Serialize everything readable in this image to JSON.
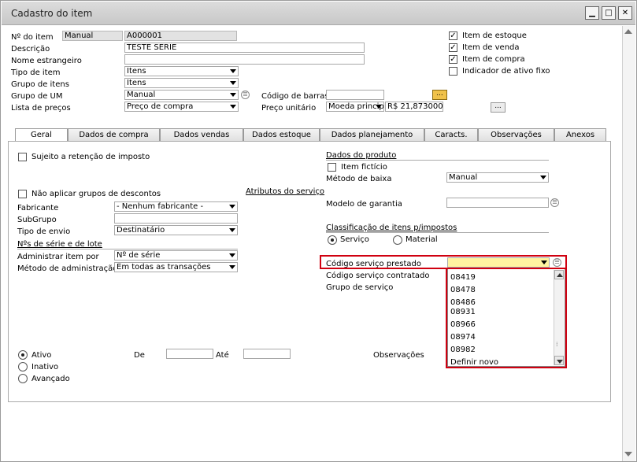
{
  "window": {
    "title": "Cadastro do item"
  },
  "header": {
    "item_no_label": "Nº do item",
    "item_no_series": "Manual",
    "item_no_value": "A000001",
    "descricao_label": "Descrição",
    "descricao_value": "TESTE SERIE",
    "nome_estrangeiro_label": "Nome estrangeiro",
    "nome_estrangeiro_value": "",
    "tipo_item_label": "Tipo de item",
    "tipo_item_value": "Itens",
    "grupo_itens_label": "Grupo de itens",
    "grupo_itens_value": "Itens",
    "grupo_um_label": "Grupo de UM",
    "grupo_um_value": "Manual",
    "lista_precos_label": "Lista de preços",
    "lista_precos_value": "Preço de compra",
    "codigo_barras_label": "Código de barras",
    "codigo_barras_value": "",
    "preco_unitario_label": "Preço unitário",
    "moeda_value": "Moeda princip",
    "preco_value": "R$ 21,873000",
    "ellipsis": "..."
  },
  "checkboxes": {
    "item_estoque": {
      "label": "Item de estoque",
      "checked": true
    },
    "item_venda": {
      "label": "Item de venda",
      "checked": true
    },
    "item_compra": {
      "label": "Item de compra",
      "checked": true
    },
    "ativo_fixo": {
      "label": "Indicador de ativo fixo",
      "checked": false
    }
  },
  "tabs": [
    "Geral",
    "Dados de compra",
    "Dados vendas",
    "Dados estoque",
    "Dados planejamento",
    "Caracts.",
    "Observações",
    "Anexos"
  ],
  "geral": {
    "sujeito_retencao": "Sujeito a retenção de imposto",
    "nao_aplicar_descontos": "Não aplicar grupos de descontos",
    "atributos_servico": "Atributos do serviço",
    "fabricante_label": "Fabricante",
    "fabricante_value": "- Nenhum fabricante -",
    "subgrupo_label": "SubGrupo",
    "subgrupo_value": "",
    "tipo_envio_label": "Tipo de envio",
    "tipo_envio_value": "Destinatário",
    "series_lote_title": "Nºs de série e de lote",
    "administrar_label": "Administrar item por",
    "administrar_value": "Nº de série",
    "metodo_admin_label": "Método de administração",
    "metodo_admin_value": "Em todas as transações",
    "dados_produto_title": "Dados do produto",
    "item_ficticio": "Item fictício",
    "metodo_baixa_label": "Método de baixa",
    "metodo_baixa_value": "Manual",
    "modelo_garantia_label": "Modelo de garantia",
    "modelo_garantia_value": "",
    "classificacao_title": "Classificação de itens p/impostos",
    "servico_label": "Serviço",
    "material_label": "Material",
    "codigo_prestado_label": "Código serviço prestado",
    "codigo_contratado_label": "Código serviço contratado",
    "grupo_servico_label": "Grupo de serviço",
    "ativo_label": "Ativo",
    "inativo_label": "Inativo",
    "avancado_label": "Avançado",
    "de_label": "De",
    "ate_label": "Até",
    "observacoes_label": "Observações"
  },
  "dropdown": {
    "items": [
      "08419",
      "08478",
      "08486",
      "08931",
      "08966",
      "08974",
      "08982",
      "Definir novo"
    ]
  },
  "colors": {
    "highlight_red": "#d00010",
    "yellow_field": "#fff3a0",
    "ellipsis_btn": "#f0c24a"
  }
}
